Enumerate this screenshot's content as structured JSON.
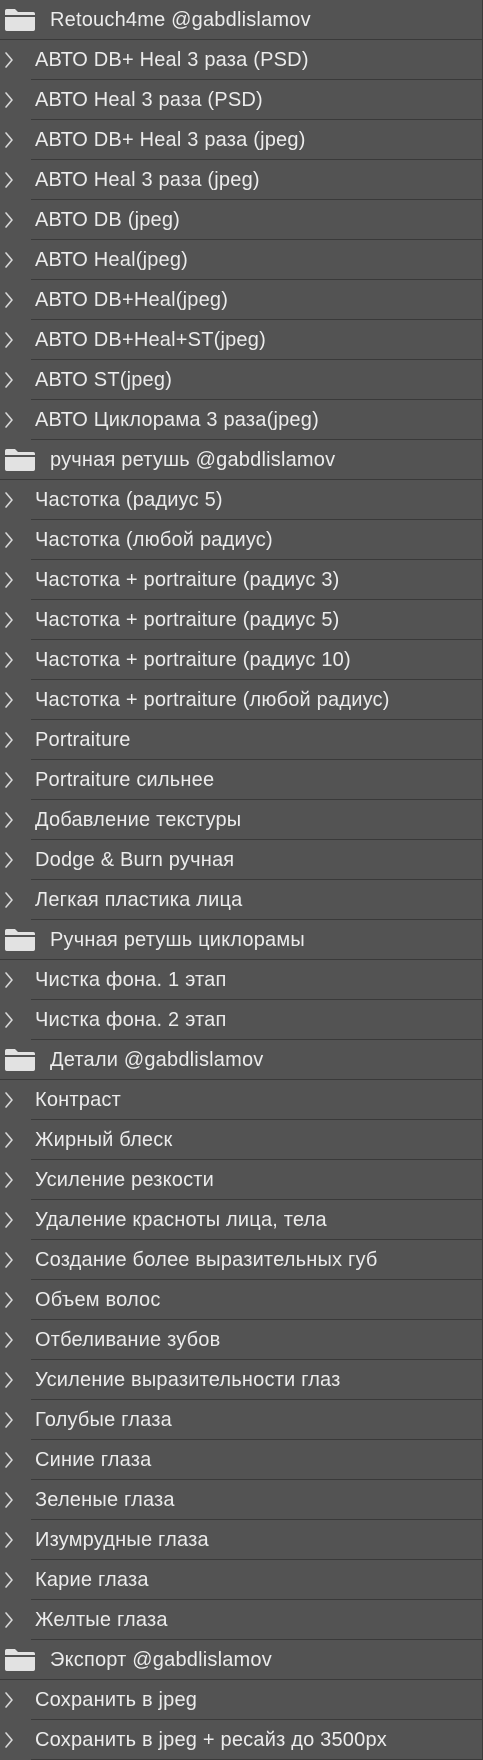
{
  "panel": {
    "sets": [
      {
        "name": "Retouch4me @gabdlislamov",
        "icon": "folder-icon",
        "actions": [
          "АВТО DB+ Heal 3 раза (PSD)",
          "АВТО Heal 3 раза (PSD)",
          "АВТО DB+ Heal 3 раза (jpeg)",
          "АВТО Heal 3 раза (jpeg)",
          "АВТО DB (jpeg)",
          "АВТО Heal(jpeg)",
          "АВТО DB+Heal(jpeg)",
          "АВТО DB+Heal+ST(jpeg)",
          "АВТО ST(jpeg)",
          "АВТО Циклорама 3 раза(jpeg)"
        ]
      },
      {
        "name": "ручная ретушь @gabdlislamov",
        "icon": "folder-icon",
        "actions": [
          "Частотка (радиус 5)",
          "Частотка (любой радиус)",
          "Частотка + portraiture (радиус 3)",
          "Частотка + portraiture (радиус 5)",
          "Частотка + portraiture (радиус 10)",
          "Частотка + portraiture (любой радиус)",
          "Portraiture",
          "Portraiture сильнее",
          "Добавление текстуры",
          "Dodge & Burn ручная",
          "Легкая пластика лица"
        ]
      },
      {
        "name": "Ручная ретушь циклорамы",
        "icon": "folder-icon",
        "actions": [
          "Чистка фона. 1 этап",
          "Чистка фона. 2 этап"
        ]
      },
      {
        "name": "Детали @gabdlislamov",
        "icon": "folder-icon",
        "actions": [
          "Контраст",
          "Жирный блеск",
          "Усиление резкости",
          "Удаление красноты лица, тела",
          "Создание более выразительных губ",
          "Объем волос",
          "Отбеливание зубов",
          "Усиление выразительности глаз",
          "Голубые глаза",
          "Синие глаза",
          "Зеленые глаза",
          "Изумрудные глаза",
          "Карие глаза",
          "Желтые глаза"
        ]
      },
      {
        "name": "Экспорт @gabdlislamov",
        "icon": "folder-icon",
        "actions": [
          "Сохранить в jpeg",
          "Сохранить в jpeg + ресайз до 3500px"
        ]
      }
    ]
  },
  "colors": {
    "panel_bg": "#535353",
    "divider": "#3a3a3a",
    "text": "#ececec",
    "chevron": "#d8d8d8",
    "folder": "#e2e2e2"
  },
  "icons": {
    "expand": "chevron-right-icon",
    "set": "folder-icon"
  }
}
